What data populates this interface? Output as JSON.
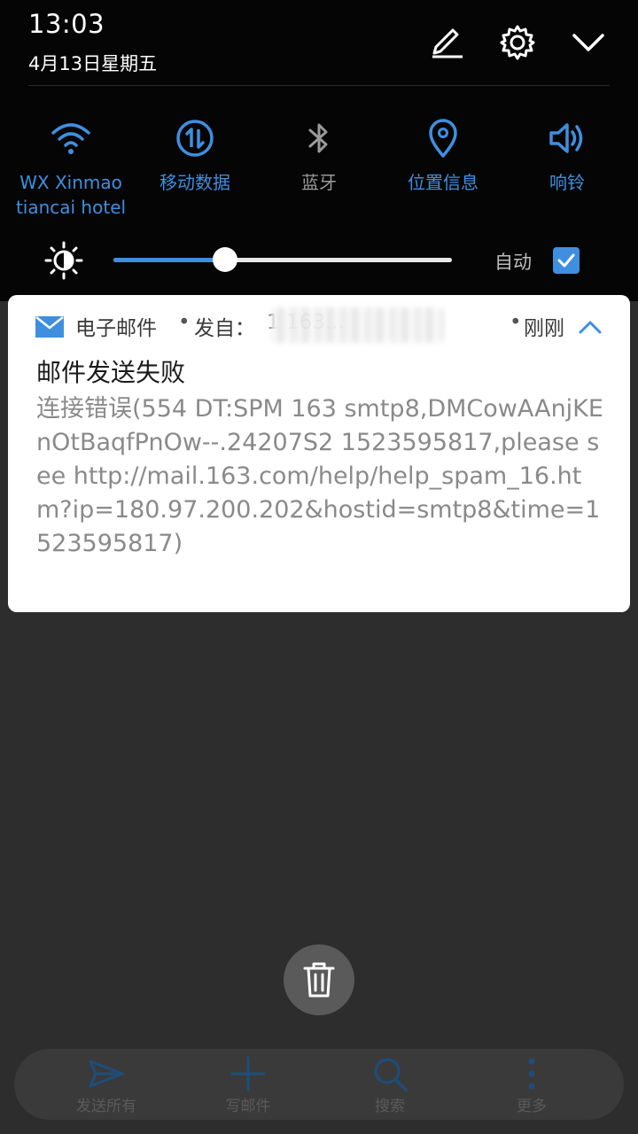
{
  "status": {
    "time": "13:03",
    "date": "4月13日星期五"
  },
  "quick_settings": [
    {
      "label_line1": "WX Xinmao",
      "label_line2": "tiancai hotel",
      "icon": "wifi-icon",
      "active": true
    },
    {
      "label_line1": "移动数据",
      "label_line2": "",
      "icon": "mobile-data-icon",
      "active": true
    },
    {
      "label_line1": "蓝牙",
      "label_line2": "",
      "icon": "bluetooth-icon",
      "active": false
    },
    {
      "label_line1": "位置信息",
      "label_line2": "",
      "icon": "location-icon",
      "active": true
    },
    {
      "label_line1": "响铃",
      "label_line2": "",
      "icon": "ring-icon",
      "active": true
    }
  ],
  "brightness": {
    "level_percent": 33,
    "auto_label": "自动",
    "auto_checked": true
  },
  "notification": {
    "app_name": "电子邮件",
    "separator": "•",
    "from_label": "发自：",
    "sender_visible": "1                       163...",
    "time_ago": "刚刚",
    "title": "邮件发送失败",
    "body": "连接错误(554 DT:SPM 163 smtp8,DMCowAAnjKEnOtBaqfPnOw--.24207S2 1523595817,please see http://mail.163.com/help/help_spam_16.htm?ip=180.97.200.202&hostid=smtp8&time=1523595817)"
  },
  "toolbar": [
    {
      "label": "发送所有",
      "icon": "send-icon"
    },
    {
      "label": "写邮件",
      "icon": "plus-icon"
    },
    {
      "label": "搜索",
      "icon": "search-icon"
    },
    {
      "label": "更多",
      "icon": "more-icon"
    }
  ],
  "colors": {
    "accent": "#3f8fe0",
    "shade_bg": "#050505",
    "dim_bg": "#2d2d2d"
  }
}
